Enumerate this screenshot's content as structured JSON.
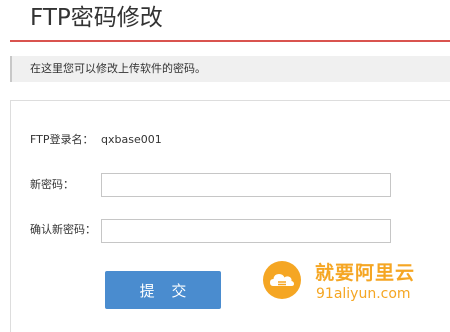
{
  "header": {
    "title": "FTP密码修改"
  },
  "info": {
    "text": "在这里您可以修改上传软件的密码。"
  },
  "form": {
    "ftp_login_label": "FTP登录名：",
    "ftp_login_value": "qxbase001",
    "new_password_label": "新密码：",
    "new_password_value": "",
    "confirm_password_label": "确认新密码：",
    "confirm_password_value": "",
    "submit_label": "提 交"
  },
  "watermark": {
    "title": "就要阿里云",
    "url": "91aliyun.com",
    "logo_icon": "cloud-icon",
    "color": "#f5a623"
  },
  "colors": {
    "accent_rule": "#d9534f",
    "button": "#4a8ccf",
    "info_bg": "#f0f0f0"
  }
}
